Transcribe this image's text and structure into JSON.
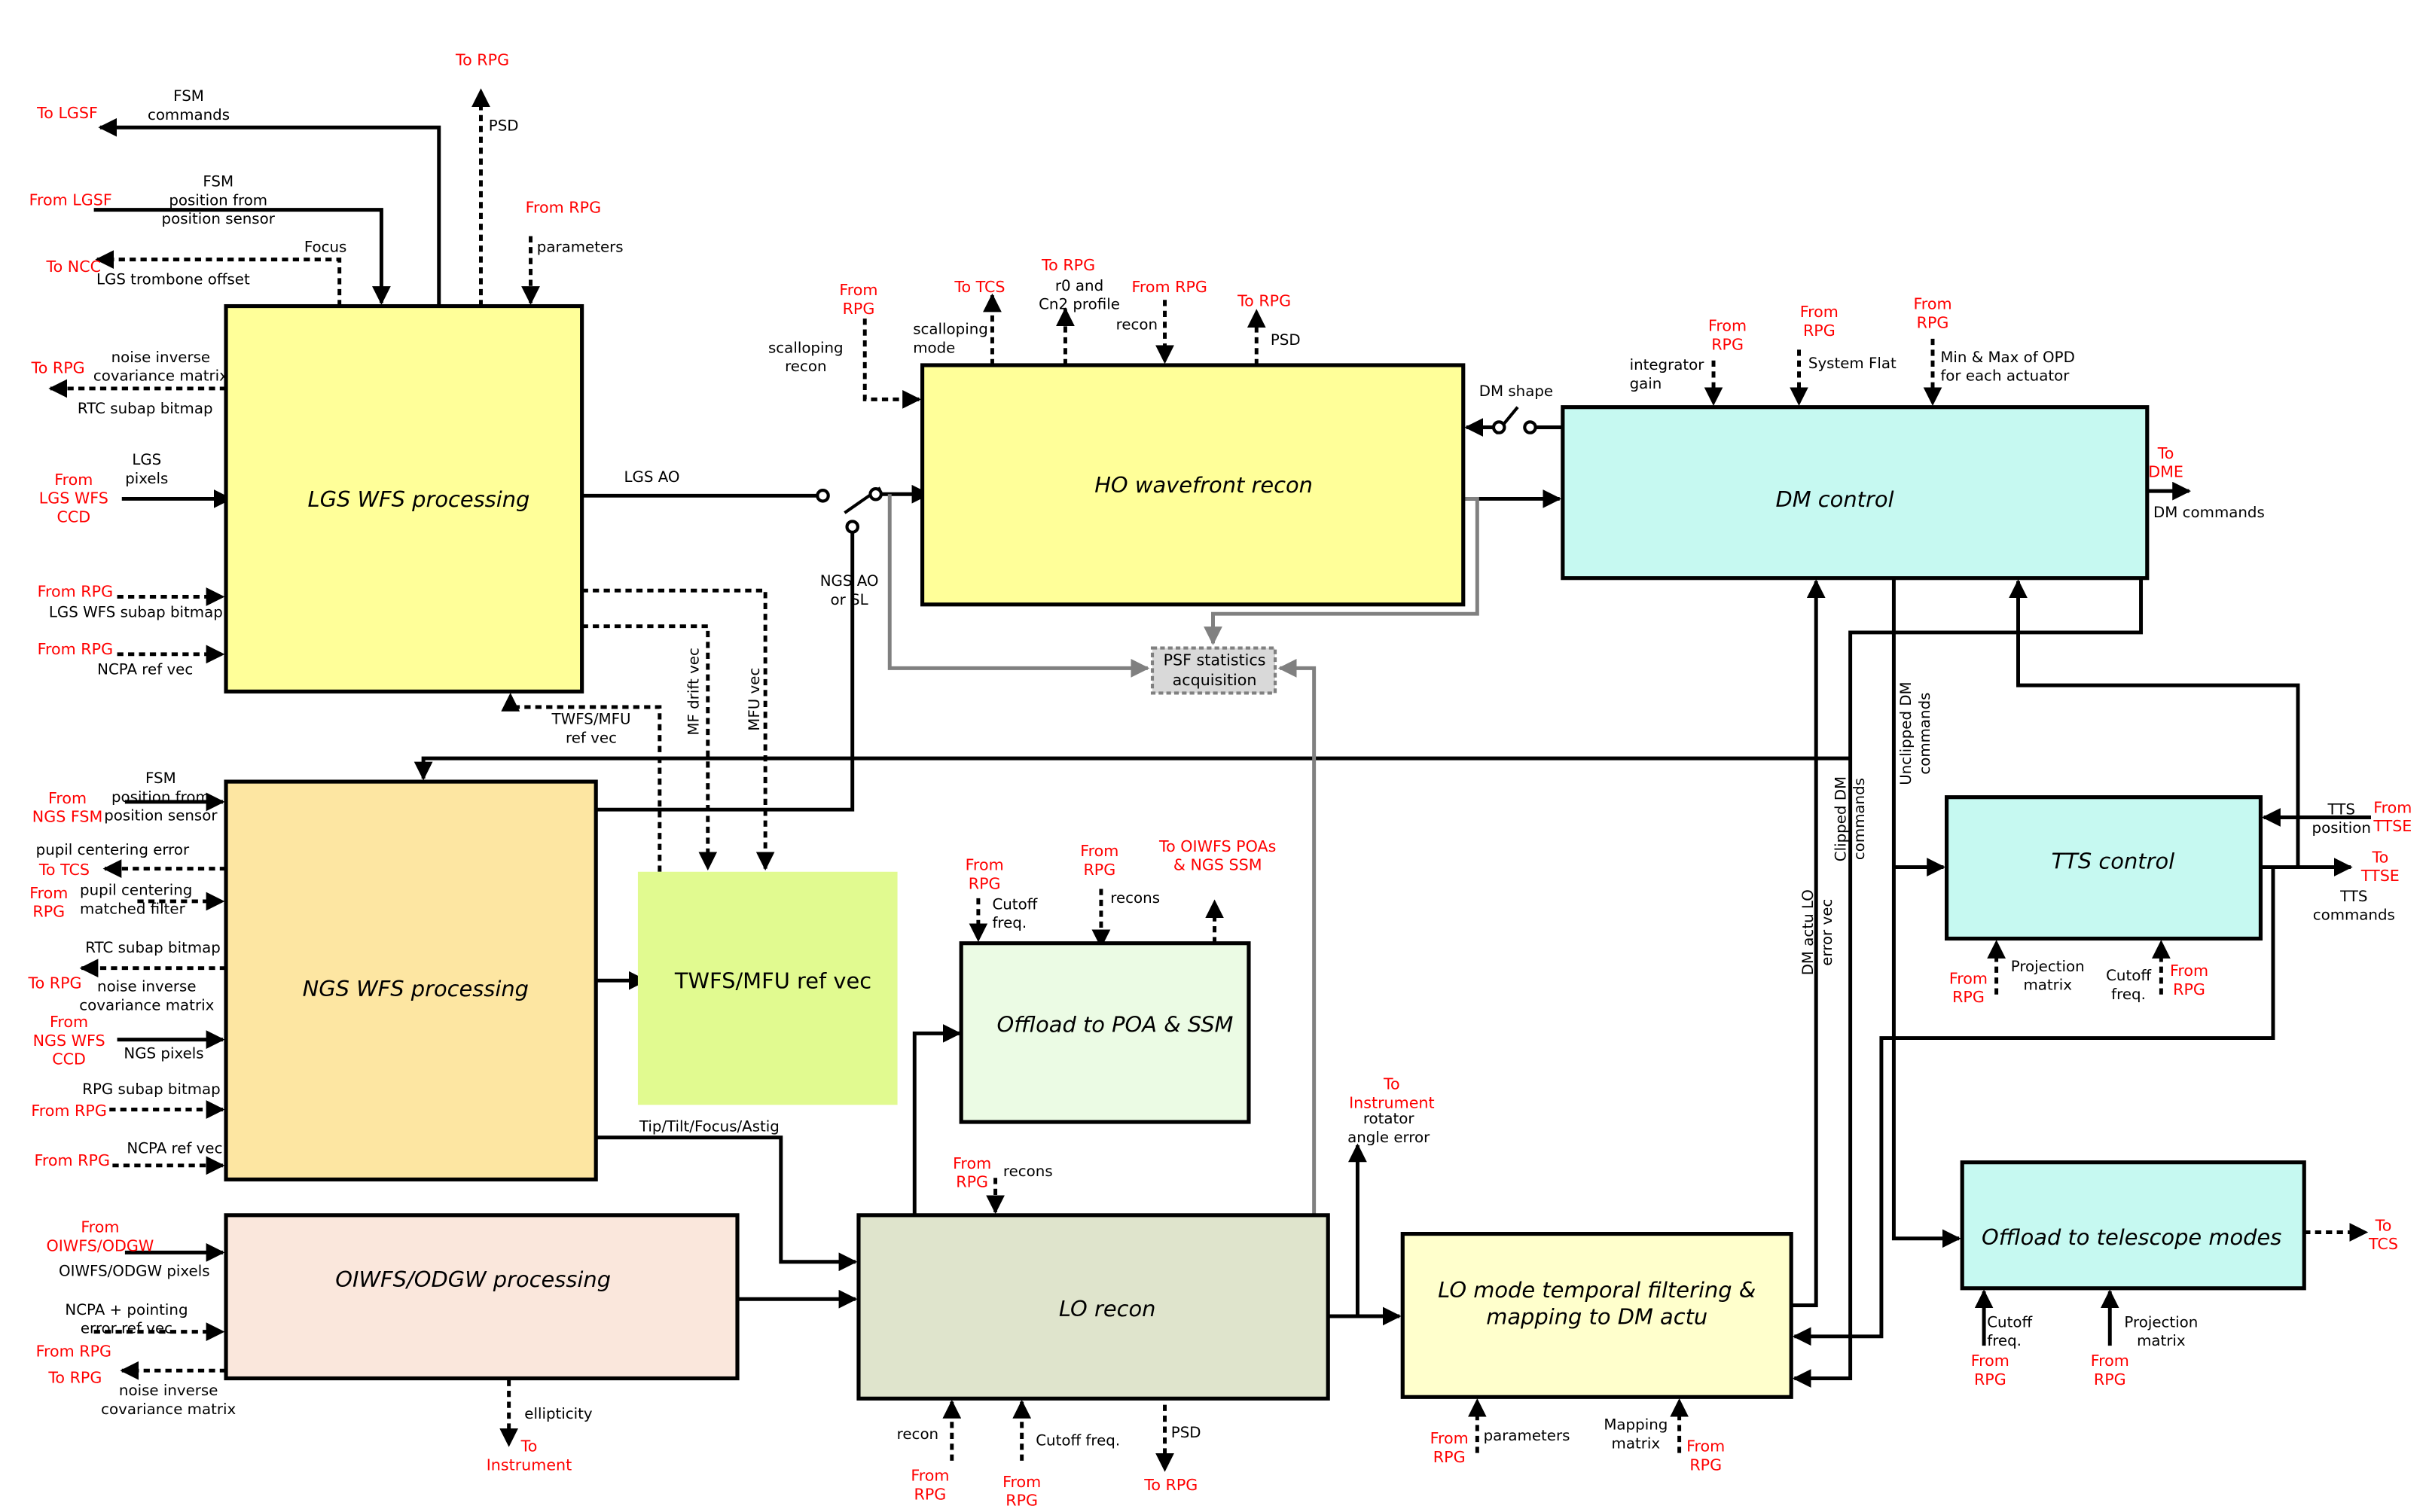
{
  "colors": {
    "external_label": "#ff0000",
    "lgs_wfs": "#ffff99",
    "ho_recon": "#ffff99",
    "dm_control": "#c6f9f1",
    "ngs_wfs": "#fde6a2",
    "twfs_mfu": "#e1fa90",
    "offload_poa": "#ebfbe4",
    "oiwfs": "#fae7dc",
    "lo_recon": "#dfe4cc",
    "lo_filter": "#ffffcc",
    "tts_control": "#c6f9f1",
    "offload_tel": "#c6f9f1",
    "psf": "#d9d9d9"
  },
  "blocks": {
    "lgs_wfs": "LGS WFS processing",
    "ho_recon": "HO wavefront recon",
    "dm_control": "DM control",
    "ngs_wfs": "NGS WFS processing",
    "twfs_mfu": "TWFS/MFU ref vec",
    "offload_poa": "Offload to POA & SSM",
    "oiwfs": "OIWFS/ODGW processing",
    "lo_recon": "LO recon",
    "lo_filter": [
      "LO mode temporal filtering &",
      "mapping to DM actu"
    ],
    "tts_control": "TTS control",
    "offload_tel": "Offload to telescope modes",
    "psf": [
      "PSF statistics",
      "acquisition"
    ]
  },
  "ext": {
    "lgs_to_rpg_psd": "To RPG",
    "to_lgsf": "To LGSF",
    "from_lgsf": "From LGSF",
    "to_ncc": "To NCC",
    "lgs_to_rpg_noise": "To RPG",
    "from_lgs_ccd": [
      "From",
      "LGS WFS",
      "CCD"
    ],
    "lgs_from_rpg_params": "From RPG",
    "lgs_from_rpg_bitmap": "From RPG",
    "lgs_from_rpg_ncpa": "From RPG",
    "ho_from_rpg_scallop": [
      "From",
      "RPG"
    ],
    "ho_to_tcs": "To TCS",
    "ho_to_rpg_r0": "To RPG",
    "ho_from_rpg_recon": "From RPG",
    "ho_to_rpg_psd": "To RPG",
    "dm_from_rpg_gain": [
      "From",
      "RPG"
    ],
    "dm_from_rpg_flat": [
      "From",
      "RPG"
    ],
    "dm_from_rpg_minmax": [
      "From",
      "RPG"
    ],
    "to_dme": [
      "To",
      "DME"
    ],
    "ngs_from_fsm": [
      "From",
      "NGS FSM"
    ],
    "ngs_to_tcs": "To TCS",
    "ngs_from_rpg_mf": [
      "From",
      "RPG"
    ],
    "ngs_to_rpg": "To RPG",
    "from_ngs_ccd": [
      "From",
      "NGS WFS",
      "CCD"
    ],
    "ngs_from_rpg_bitmap": "From RPG",
    "ngs_from_rpg_ncpa": "From RPG",
    "from_oiwfs": [
      "From",
      "OIWFS/ODGW"
    ],
    "oi_from_rpg": "From RPG",
    "oi_to_rpg": "To RPG",
    "to_instrument_ell": [
      "To",
      "Instrument"
    ],
    "poa_from_rpg_cutoff": [
      "From",
      "RPG"
    ],
    "poa_from_rpg_recons": [
      "From",
      "RPG"
    ],
    "to_oiwfs_poas": [
      "To OIWFS POAs",
      "& NGS SSM"
    ],
    "lo_from_rpg_recons": [
      "From",
      "RPG"
    ],
    "lo_from_rpg_recon": [
      "From",
      "RPG"
    ],
    "lo_from_rpg_cutoff": [
      "From",
      "RPG"
    ],
    "lo_to_rpg_psd": "To RPG",
    "to_instrument_rot": [
      "To",
      "Instrument"
    ],
    "filt_from_rpg_params": [
      "From",
      "RPG"
    ],
    "filt_from_rpg_map": [
      "From",
      "RPG"
    ],
    "from_ttse": [
      "From",
      "TTSE"
    ],
    "to_ttse": [
      "To",
      "TTSE"
    ],
    "tts_from_rpg_proj": [
      "From",
      "RPG"
    ],
    "tts_from_rpg_cutoff": [
      "From",
      "RPG"
    ],
    "to_tcs_tel": [
      "To",
      "TCS"
    ],
    "tel_from_rpg_cutoff": [
      "From",
      "RPG"
    ],
    "tel_from_rpg_proj": [
      "From",
      "RPG"
    ]
  },
  "sig": {
    "fsm_commands": [
      "FSM",
      "commands"
    ],
    "fsm_position": [
      "FSM",
      "position from",
      "position sensor"
    ],
    "focus": "Focus",
    "lgs_trombone": "LGS trombone offset",
    "psd_lgs": "PSD",
    "parameters_lgs": "parameters",
    "lgs_noise": [
      "noise inverse",
      "covariance matrix"
    ],
    "rtc_subap_lgs": "RTC subap bitmap",
    "lgs_pixels": [
      "LGS",
      "pixels"
    ],
    "lgs_subap": "LGS WFS subap bitmap",
    "ncpa_lgs": "NCPA ref vec",
    "lgs_ao": "LGS AO",
    "ngs_ao": [
      "NGS AO",
      "or SL"
    ],
    "twfs_mfu_ref": [
      "TWFS/MFU",
      "ref vec"
    ],
    "mf_drift": "MF drift vec",
    "mfu_vec": "MFU vec",
    "scalloping_recon": [
      "scalloping",
      "recon"
    ],
    "scalloping_mode": [
      "scalloping",
      "mode"
    ],
    "r0_profile": [
      "r0 and",
      "Cn2 profile"
    ],
    "recon_ho": "recon",
    "psd_ho": "PSD",
    "dm_shape": "DM shape",
    "integrator_gain": [
      "integrator",
      "gain"
    ],
    "system_flat": "System Flat",
    "min_max_opd": [
      "Min & Max of OPD",
      "for each actuator"
    ],
    "dm_commands": "DM commands",
    "ngs_fsm": [
      "FSM",
      "position from",
      "position sensor"
    ],
    "pupil_err": "pupil centering error",
    "pupil_mf": [
      "pupil centering",
      "matched filter"
    ],
    "rtc_subap_ngs": "RTC subap bitmap",
    "ngs_noise": [
      "noise inverse",
      "covariance matrix"
    ],
    "ngs_pixels": "NGS pixels",
    "rpg_subap": "RPG subap bitmap",
    "ncpa_ngs": "NCPA ref vec",
    "tip_tilt": "Tip/Tilt/Focus/Astig",
    "oiwfs_pixels": "OIWFS/ODGW pixels",
    "ncpa_pointing": [
      "NCPA + pointing",
      "error ref vec"
    ],
    "oi_noise": [
      "noise inverse",
      "covariance matrix"
    ],
    "ellipticity": "ellipticity",
    "cutoff_poa": [
      "Cutoff",
      "freq."
    ],
    "recons_poa": "recons",
    "recons_lo": "recons",
    "recon_lo": "recon",
    "cutoff_lo": "Cutoff freq.",
    "psd_lo": "PSD",
    "rotator": [
      "rotator",
      "angle error"
    ],
    "parameters_filt": "parameters",
    "mapping": [
      "Mapping",
      "matrix"
    ],
    "clipped_dm": [
      "Clipped DM",
      "commands"
    ],
    "unclipped_dm": [
      "Unclipped DM",
      "commands"
    ],
    "dm_actu_lo": [
      "DM actu LO",
      "error vec"
    ],
    "tts_position": [
      "TTS",
      "position"
    ],
    "tts_commands": [
      "TTS",
      "commands"
    ],
    "proj_tts": [
      "Projection",
      "matrix"
    ],
    "cutoff_tts": [
      "Cutoff",
      "freq."
    ],
    "cutoff_tel": [
      "Cutoff",
      "freq."
    ],
    "proj_tel": [
      "Projection",
      "matrix"
    ]
  }
}
